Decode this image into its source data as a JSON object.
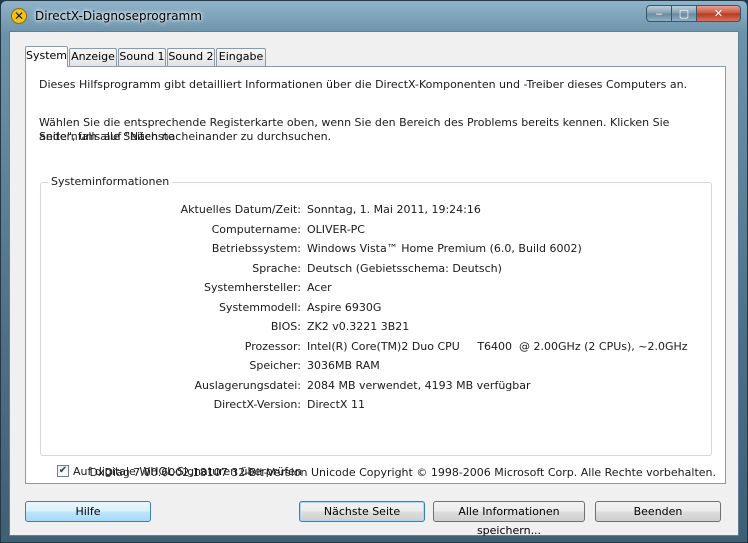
{
  "window": {
    "title": "DirectX-Diagnoseprogramm"
  },
  "titlebar": {
    "min_glyph": "‒",
    "max_glyph": "▢",
    "close_glyph": "✕",
    "icon_glyph": "✕"
  },
  "tabs": [
    {
      "label": "System",
      "active": true
    },
    {
      "label": "Anzeige",
      "active": false
    },
    {
      "label": "Sound 1",
      "active": false
    },
    {
      "label": "Sound 2",
      "active": false
    },
    {
      "label": "Eingabe",
      "active": false
    }
  ],
  "intro": {
    "line1": "Dieses Hilfsprogramm gibt detailliert Informationen über die DirectX-Komponenten und -Treiber dieses Computers an.",
    "line2a": "Wählen Sie die entsprechende Registerkarte oben, wenn Sie den Bereich des Problems bereits kennen. Klicken Sie andernfalls auf \"Nächste",
    "line2b": "Seite\", um alle Seiten nacheinander zu durchsuchen."
  },
  "sysinfo": {
    "title": "Systeminformationen",
    "rows": [
      {
        "label": "Aktuelles Datum/Zeit:",
        "value": "Sonntag, 1. Mai 2011, 19:24:16"
      },
      {
        "label": "Computername:",
        "value": "OLIVER-PC"
      },
      {
        "label": "Betriebssystem:",
        "value": "Windows Vista™ Home Premium (6.0, Build 6002)"
      },
      {
        "label": "Sprache:",
        "value": "Deutsch (Gebietsschema: Deutsch)"
      },
      {
        "label": "Systemhersteller:",
        "value": "Acer"
      },
      {
        "label": "Systemmodell:",
        "value": "Aspire 6930G"
      },
      {
        "label": "BIOS:",
        "value": "ZK2 v0.3221 3B21"
      },
      {
        "label": "Prozessor:",
        "value": "Intel(R) Core(TM)2 Duo CPU     T6400  @ 2.00GHz (2 CPUs), ~2.0GHz"
      },
      {
        "label": "Speicher:",
        "value": "3036MB RAM"
      },
      {
        "label": "Auslagerungsdatei:",
        "value": "2084 MB verwendet, 4193 MB verfügbar"
      },
      {
        "label": "DirectX-Version:",
        "value": "DirectX 11"
      }
    ]
  },
  "whql": {
    "label": "Auf digitale WHQL-Signaturen überprüfen",
    "checked": true,
    "glyph": "✔"
  },
  "footer": {
    "text": "DxDiag 7.00.6002.18107 32-Bit-Version Unicode Copyright © 1998-2006 Microsoft Corp. Alle Rechte vorbehalten."
  },
  "buttons": {
    "help": "Hilfe",
    "next": "Nächste Seite",
    "save_all": "Alle Informationen speichern...",
    "exit": "Beenden"
  }
}
